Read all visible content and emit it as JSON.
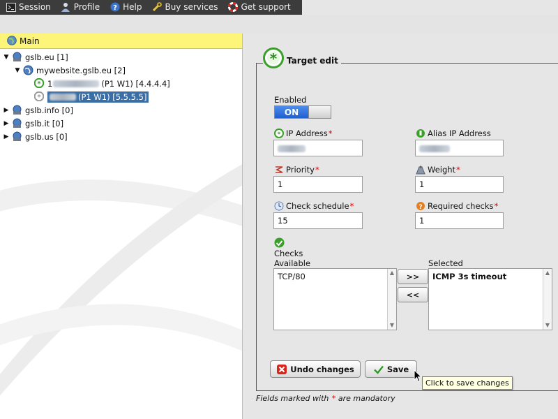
{
  "menu": {
    "items": [
      {
        "label": "Session",
        "icon": "terminal-icon"
      },
      {
        "label": "Profile",
        "icon": "user-icon"
      },
      {
        "label": "Help",
        "icon": "help-icon"
      },
      {
        "label": "Buy services",
        "icon": "wrench-icon"
      },
      {
        "label": "Get support",
        "icon": "lifebuoy-icon"
      }
    ]
  },
  "tree": {
    "header": "Main",
    "nodes": [
      {
        "label": "gslb.eu [1]"
      },
      {
        "label": "mywebsite.gslb.eu [2]"
      },
      {
        "prefix": "1",
        "label": "(P1 W1) [4.4.4.4]"
      },
      {
        "label": "(P1 W1) [5.5.5.5]"
      },
      {
        "label": "gslb.info [0]"
      },
      {
        "label": "gslb.it [0]"
      },
      {
        "label": "gslb.us [0]"
      }
    ]
  },
  "form": {
    "legend": "Target edit",
    "enabled_label": "Enabled",
    "toggle_label": "ON",
    "ip_label": "IP Address",
    "alias_label": "Alias IP Address",
    "priority_label": "Priority",
    "priority_value": "1",
    "weight_label": "Weight",
    "weight_value": "1",
    "schedule_label": "Check schedule",
    "schedule_value": "15",
    "required_label": "Required checks",
    "required_value": "1",
    "checks_label": "Checks",
    "available_label": "Available",
    "available_items": [
      "TCP/80"
    ],
    "selected_label": "Selected",
    "selected_items": [
      "ICMP 3s timeout"
    ],
    "add_btn": ">>",
    "remove_btn": "<<",
    "undo_btn": "Undo changes",
    "save_btn": "Save",
    "tooltip": "Click to save changes",
    "mandatory_before": "Fields marked with",
    "mandatory_star": "*",
    "mandatory_after": "are mandatory",
    "required_star": "*"
  },
  "colors": {
    "menu_bg": "#3c3c3c",
    "main_header_bg": "#fdf57a",
    "selected_node_bg": "#3b6ea5",
    "toggle_on": "#2f6fe0",
    "required": "#d40000"
  }
}
